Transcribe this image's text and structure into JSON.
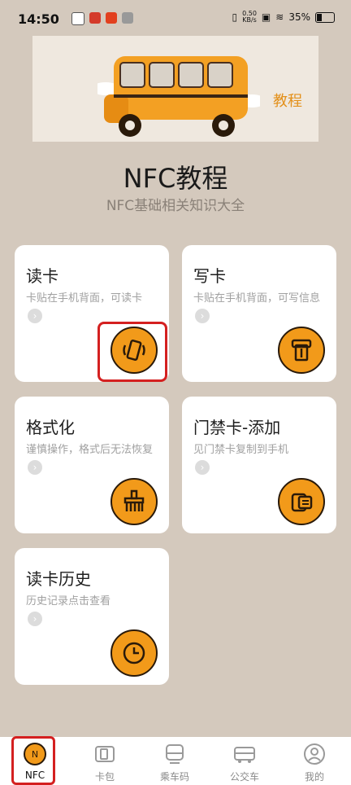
{
  "status": {
    "time": "14:50",
    "net_speed": "0.50\nKB/s",
    "battery": "35%"
  },
  "header": {
    "tutorial_link": "教程"
  },
  "app": {
    "title": "NFC教程",
    "subtitle": "NFC基础相关知识大全"
  },
  "cards": [
    {
      "title": "读卡",
      "desc": "卡贴在手机背面，可读卡",
      "icon": "nfc-read-icon"
    },
    {
      "title": "写卡",
      "desc": "卡贴在手机背面，可写信息",
      "icon": "card-write-icon"
    },
    {
      "title": "格式化",
      "desc": "谨慎操作，格式后无法恢复",
      "icon": "format-icon"
    },
    {
      "title": "门禁卡-添加",
      "desc": "见门禁卡复制到手机",
      "icon": "access-card-icon"
    },
    {
      "title": "读卡历史",
      "desc": "历史记录点击查看",
      "icon": "clock-icon"
    }
  ],
  "tabs": [
    {
      "label": "NFC",
      "icon": "nfc-tab-icon",
      "active": true
    },
    {
      "label": "卡包",
      "icon": "wallet-icon"
    },
    {
      "label": "乘车码",
      "icon": "metro-icon"
    },
    {
      "label": "公交车",
      "icon": "bus-icon"
    },
    {
      "label": "我的",
      "icon": "profile-icon"
    }
  ],
  "colors": {
    "accent": "#f29a1a",
    "background": "#d4c9bd",
    "highlight": "#d42020"
  }
}
